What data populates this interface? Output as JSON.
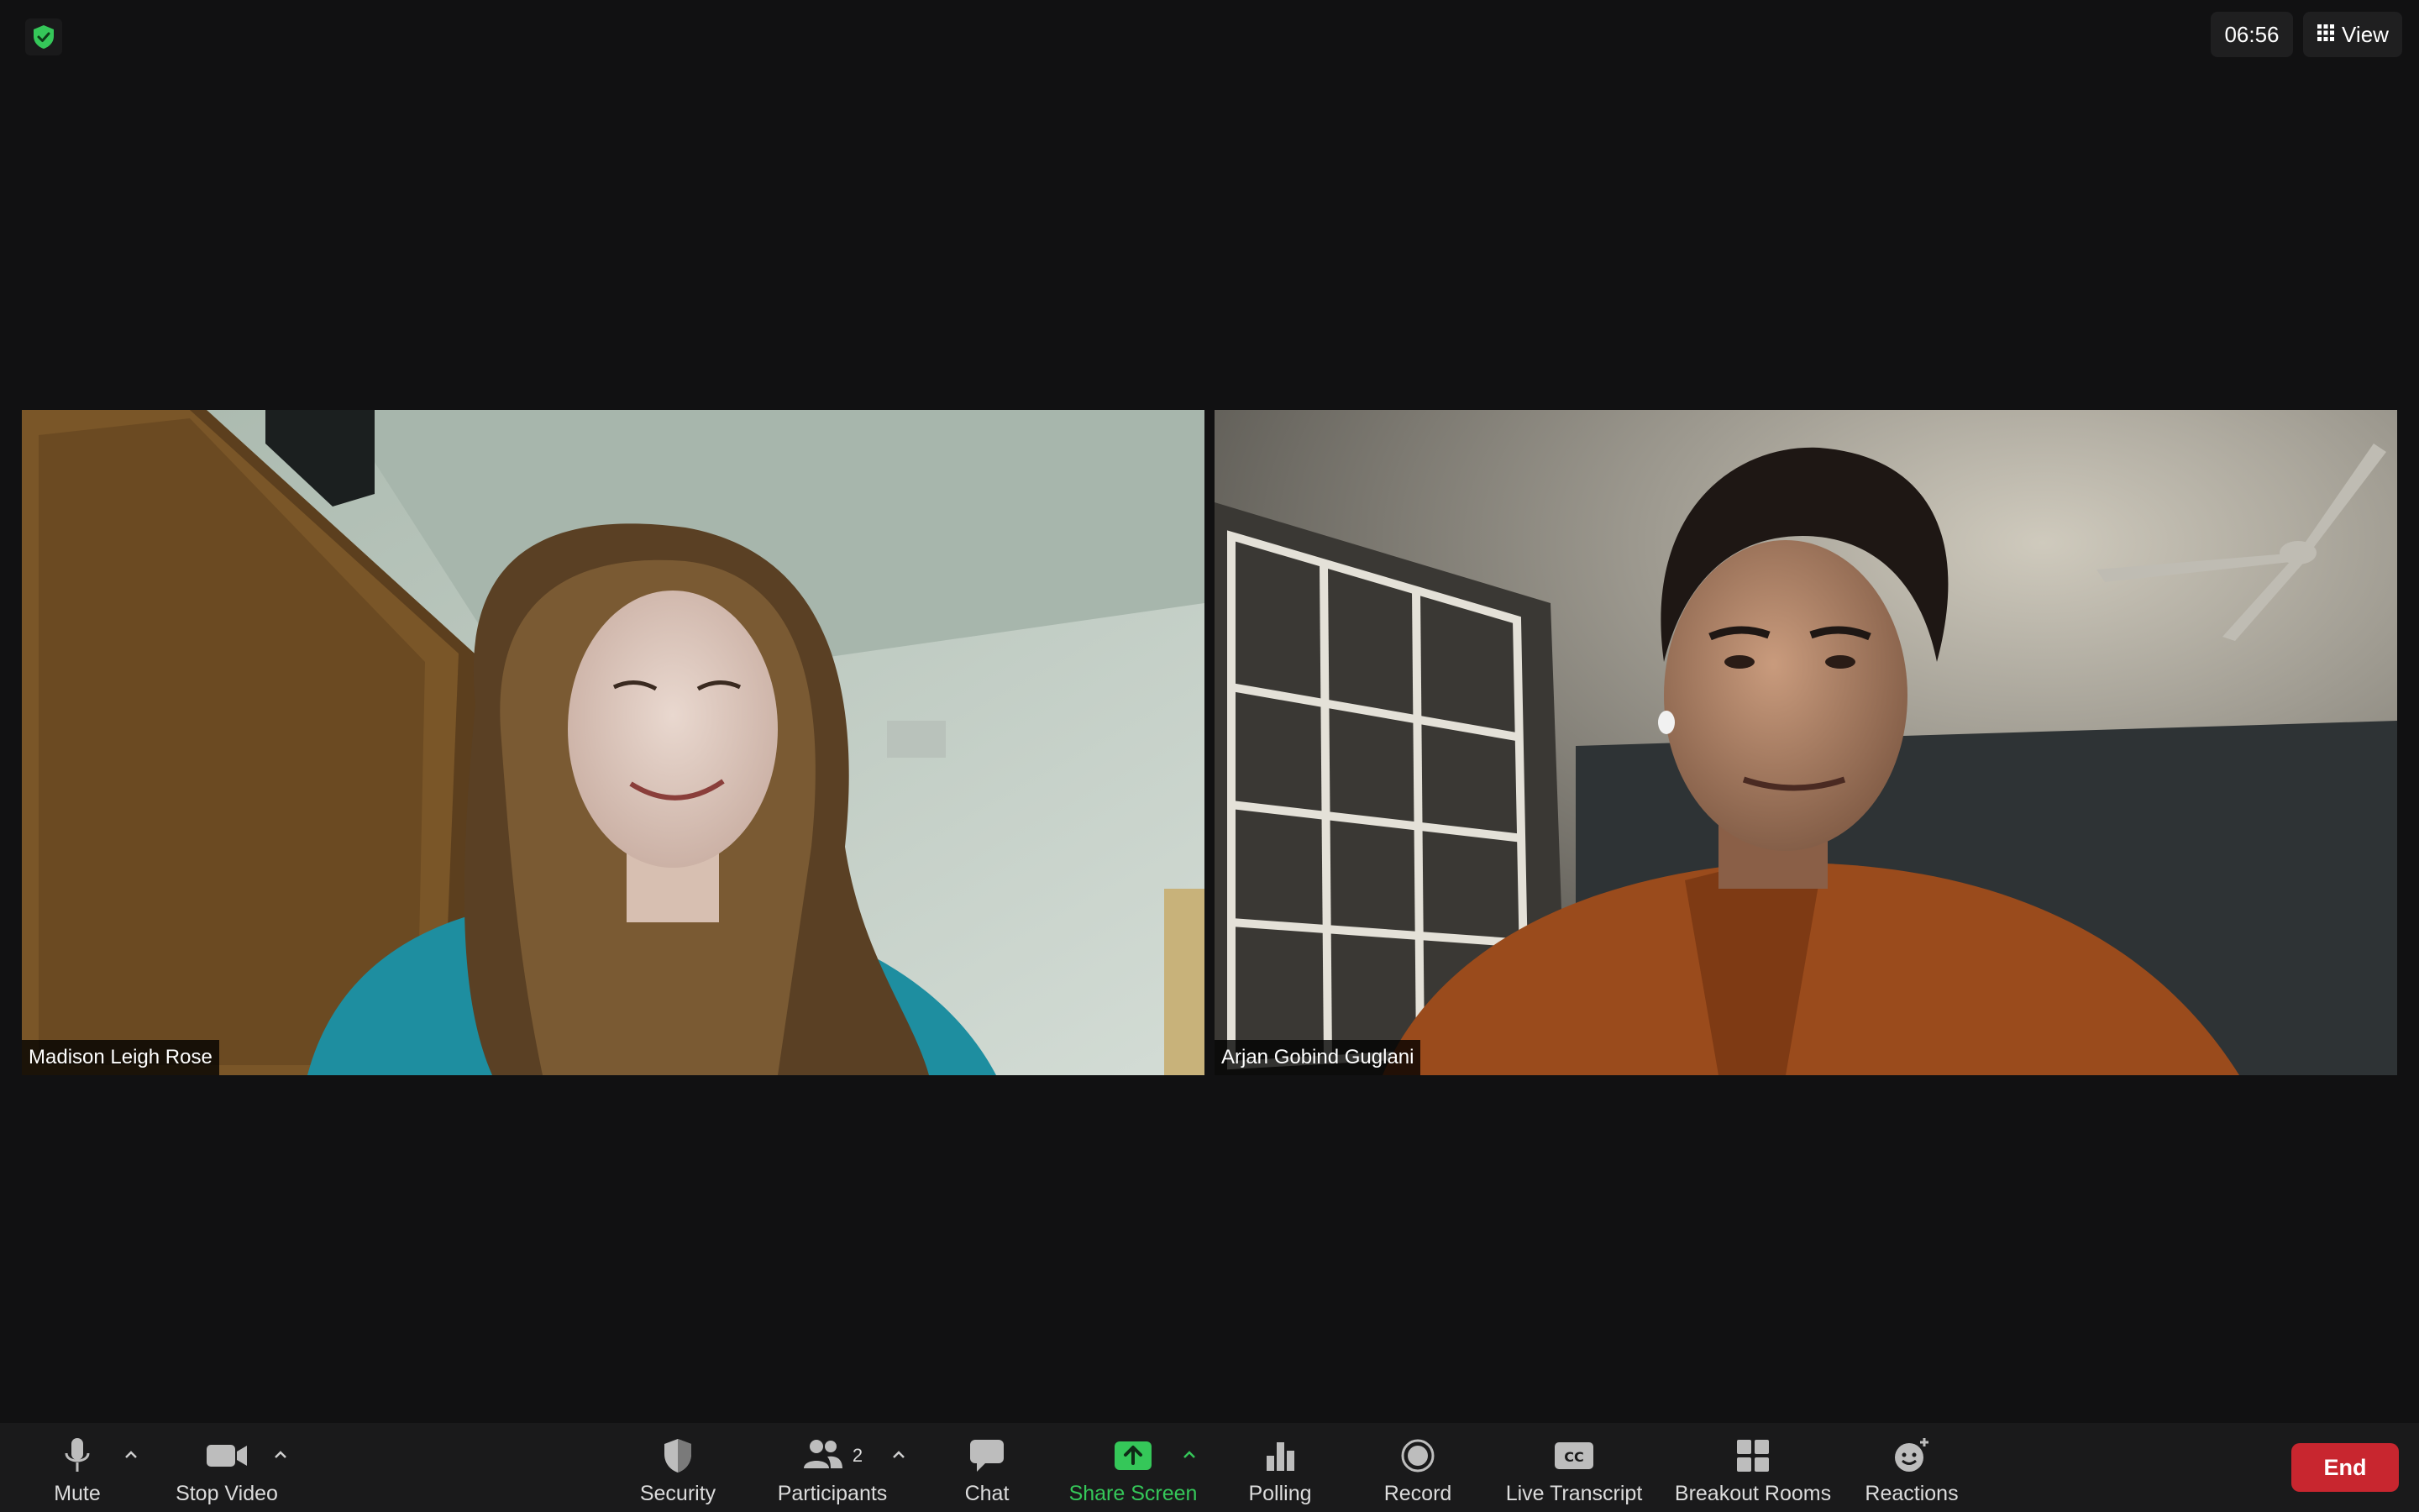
{
  "header": {
    "timer": "06:56",
    "view_label": "View"
  },
  "participants": [
    {
      "name": "Madison Leigh Rose"
    },
    {
      "name": "Arjan Gobind Guglani"
    }
  ],
  "toolbar": {
    "mute_label": "Mute",
    "stop_video_label": "Stop Video",
    "security_label": "Security",
    "participants_label": "Participants",
    "participants_count": "2",
    "chat_label": "Chat",
    "share_screen_label": "Share Screen",
    "polling_label": "Polling",
    "record_label": "Record",
    "live_transcript_label": "Live Transcript",
    "breakout_rooms_label": "Breakout Rooms",
    "reactions_label": "Reactions",
    "end_label": "End"
  },
  "colors": {
    "background": "#111112",
    "toolbar": "#1a1a1b",
    "share_green": "#35c759",
    "end_red": "#c8262f",
    "security_shield": "#35c759"
  },
  "icons": {
    "encryption": "shield-check-icon",
    "view": "grid-icon",
    "mute": "microphone-icon",
    "video": "camera-icon",
    "security": "shield-icon",
    "participants": "people-icon",
    "chat": "speech-bubble-icon",
    "share": "share-arrow-icon",
    "polling": "bar-chart-icon",
    "record": "record-icon",
    "transcript": "cc-icon",
    "breakout": "grid-squares-icon",
    "reactions": "smiley-plus-icon"
  }
}
